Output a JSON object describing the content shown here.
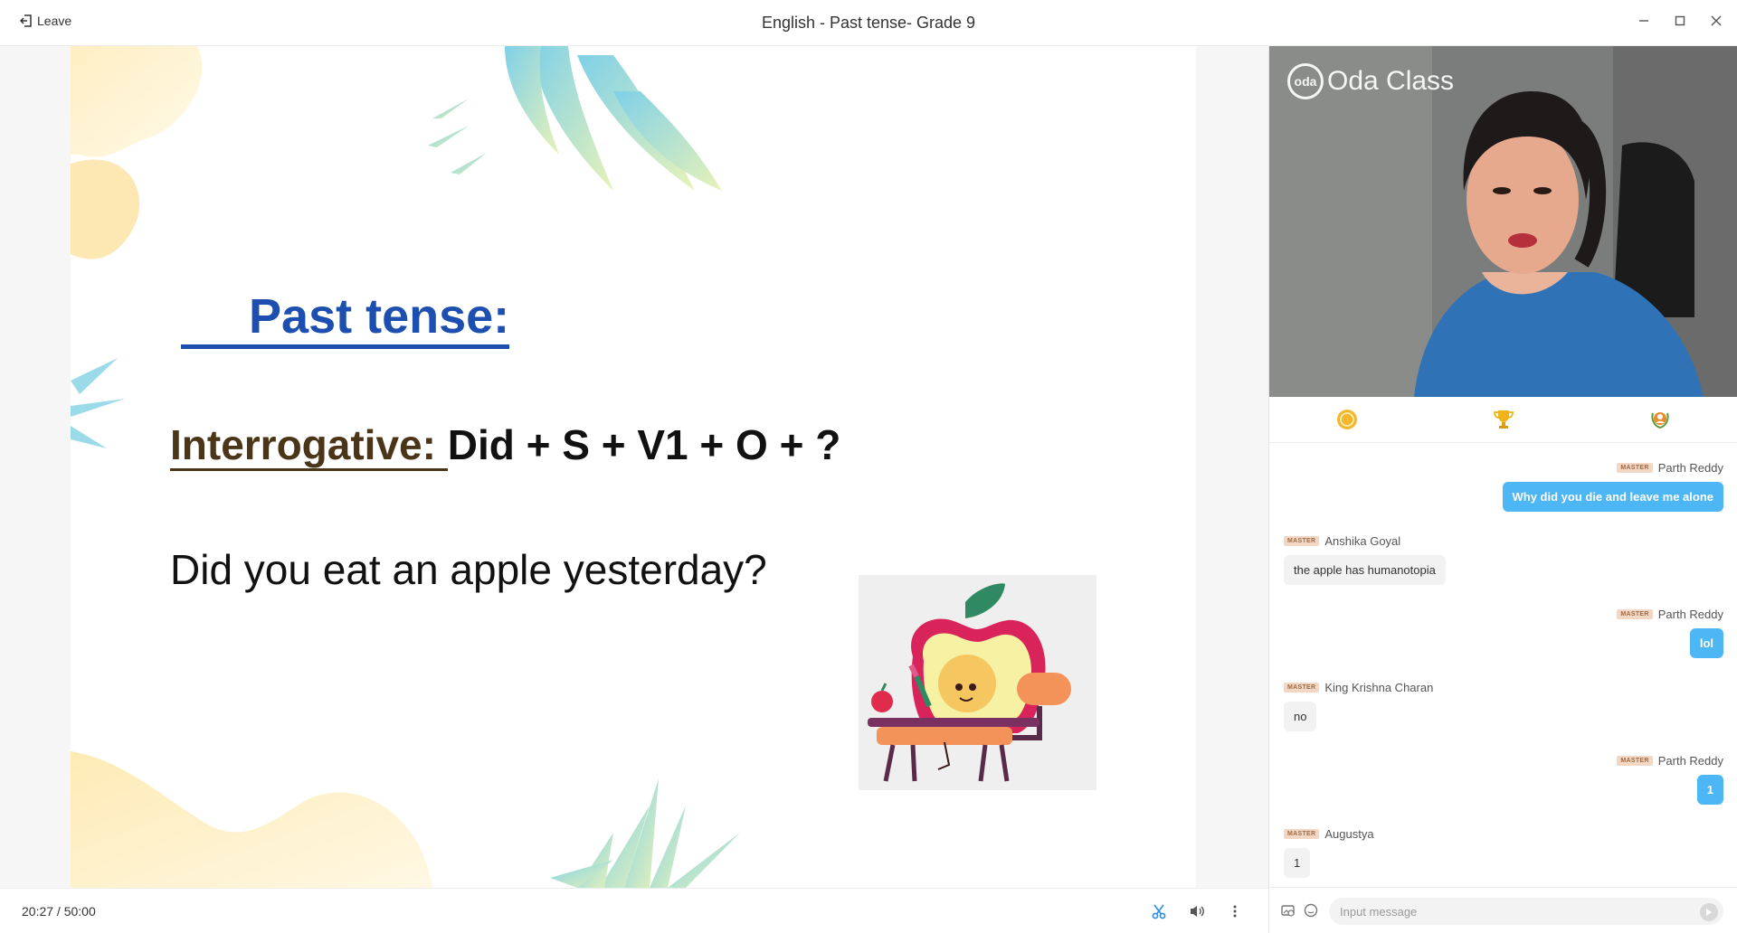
{
  "window": {
    "title": "English - Past tense- Grade 9",
    "leave_label": "Leave",
    "controls": [
      "minimize-icon",
      "maximize-icon",
      "close-icon"
    ]
  },
  "slide": {
    "title": "     Past tense:",
    "interrogative_label": "Interrogative: ",
    "formula": "Did + S + V1 + O + ?",
    "example": "Did you eat an apple yesterday?"
  },
  "playback": {
    "elapsed": "20:27",
    "separator": " / ",
    "total": "50:00"
  },
  "video": {
    "brand_mark": "oda",
    "brand_name": "Oda Class"
  },
  "side_tabs": [
    "oda-coin-icon",
    "trophy-icon",
    "medal-icon"
  ],
  "chat": {
    "badge": "MASTER",
    "messages": [
      {
        "sender": "Parth Reddy",
        "text": "Why did you die and leave me alone",
        "self": true
      },
      {
        "sender": "Anshika Goyal",
        "text": "the apple has humanotopia",
        "self": false
      },
      {
        "sender": "Parth Reddy",
        "text": "lol",
        "self": true
      },
      {
        "sender": "King Krishna Charan",
        "text": "no",
        "self": false
      },
      {
        "sender": "Parth Reddy",
        "text": "1",
        "self": true
      },
      {
        "sender": "Augustya",
        "text": "1",
        "self": false
      }
    ],
    "input_placeholder": "Input message"
  },
  "colors": {
    "accent_blue": "#1c4fb0",
    "bubble_self": "#4db6f5",
    "bubble_other": "#f2f2f2",
    "label_brown": "#4a3518"
  }
}
